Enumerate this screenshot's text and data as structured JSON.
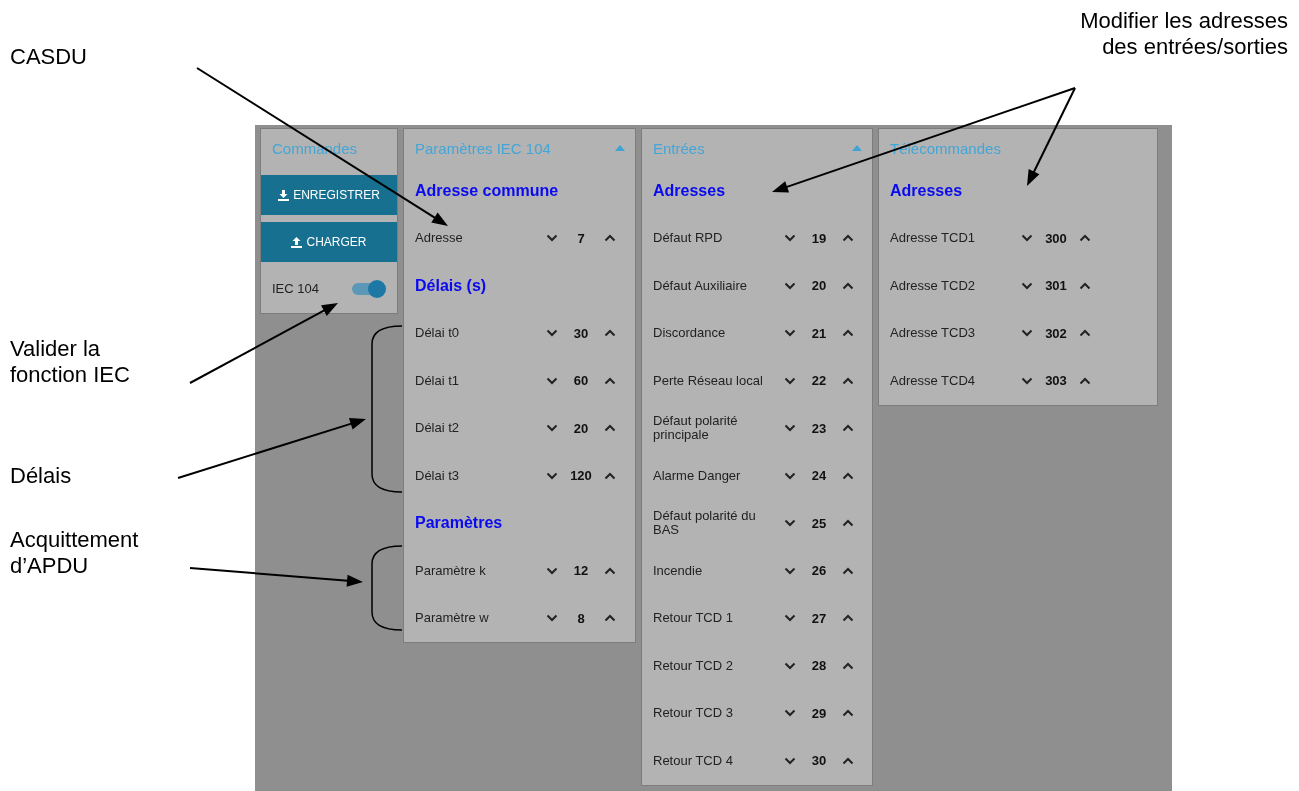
{
  "annotations": [
    {
      "text": "CASDU"
    },
    {
      "text": "Modifier les adresses\ndes entrées/sorties"
    },
    {
      "text": "Valider la\nfonction IEC"
    },
    {
      "text": "Délais"
    },
    {
      "text": "Acquittement\nd’APDU"
    }
  ],
  "panels": [
    {
      "title": "Commandes",
      "collapsible": false,
      "items": [
        {
          "kind": "save",
          "label": "ENREGISTRER"
        },
        {
          "kind": "load",
          "label": "CHARGER"
        },
        {
          "kind": "toggle",
          "label": "IEC 104",
          "on": true
        }
      ]
    },
    {
      "title": "Paramètres IEC 104",
      "collapsible": true,
      "items": [
        {
          "kind": "section",
          "label": "Adresse commune"
        },
        {
          "kind": "spinner",
          "label": "Adresse",
          "value": "7"
        },
        {
          "kind": "section",
          "label": "Délais (s)"
        },
        {
          "kind": "spinner",
          "label": "Délai t0",
          "value": "30"
        },
        {
          "kind": "spinner",
          "label": "Délai t1",
          "value": "60"
        },
        {
          "kind": "spinner",
          "label": "Délai t2",
          "value": "20"
        },
        {
          "kind": "spinner",
          "label": "Délai t3",
          "value": "120"
        },
        {
          "kind": "section",
          "label": "Paramètres"
        },
        {
          "kind": "spinner",
          "label": "Paramètre k",
          "value": "12"
        },
        {
          "kind": "spinner",
          "label": "Paramètre w",
          "value": "8"
        }
      ]
    },
    {
      "title": "Entrées",
      "collapsible": true,
      "items": [
        {
          "kind": "section",
          "label": "Adresses"
        },
        {
          "kind": "spinner",
          "label": "Défaut RPD",
          "value": "19"
        },
        {
          "kind": "spinner",
          "label": "Défaut Auxiliaire",
          "value": "20"
        },
        {
          "kind": "spinner",
          "label": "Discordance",
          "value": "21"
        },
        {
          "kind": "spinner",
          "label": "Perte Réseau local",
          "value": "22"
        },
        {
          "kind": "spinner",
          "label": "Défaut polarité principale",
          "value": "23"
        },
        {
          "kind": "spinner",
          "label": "Alarme Danger",
          "value": "24"
        },
        {
          "kind": "spinner",
          "label": "Défaut polarité du BAS",
          "value": "25"
        },
        {
          "kind": "spinner",
          "label": "Incendie",
          "value": "26"
        },
        {
          "kind": "spinner",
          "label": "Retour TCD 1",
          "value": "27"
        },
        {
          "kind": "spinner",
          "label": "Retour TCD 2",
          "value": "28"
        },
        {
          "kind": "spinner",
          "label": "Retour TCD 3",
          "value": "29"
        },
        {
          "kind": "spinner",
          "label": "Retour TCD 4",
          "value": "30"
        }
      ]
    },
    {
      "title": "Télécommandes",
      "collapsible": false,
      "items": [
        {
          "kind": "section",
          "label": "Adresses"
        },
        {
          "kind": "spinner",
          "label": "Adresse TCD1",
          "value": "300"
        },
        {
          "kind": "spinner",
          "label": "Adresse TCD2",
          "value": "301"
        },
        {
          "kind": "spinner",
          "label": "Adresse TCD3",
          "value": "302"
        },
        {
          "kind": "spinner",
          "label": "Adresse TCD4",
          "value": "303"
        }
      ]
    }
  ]
}
